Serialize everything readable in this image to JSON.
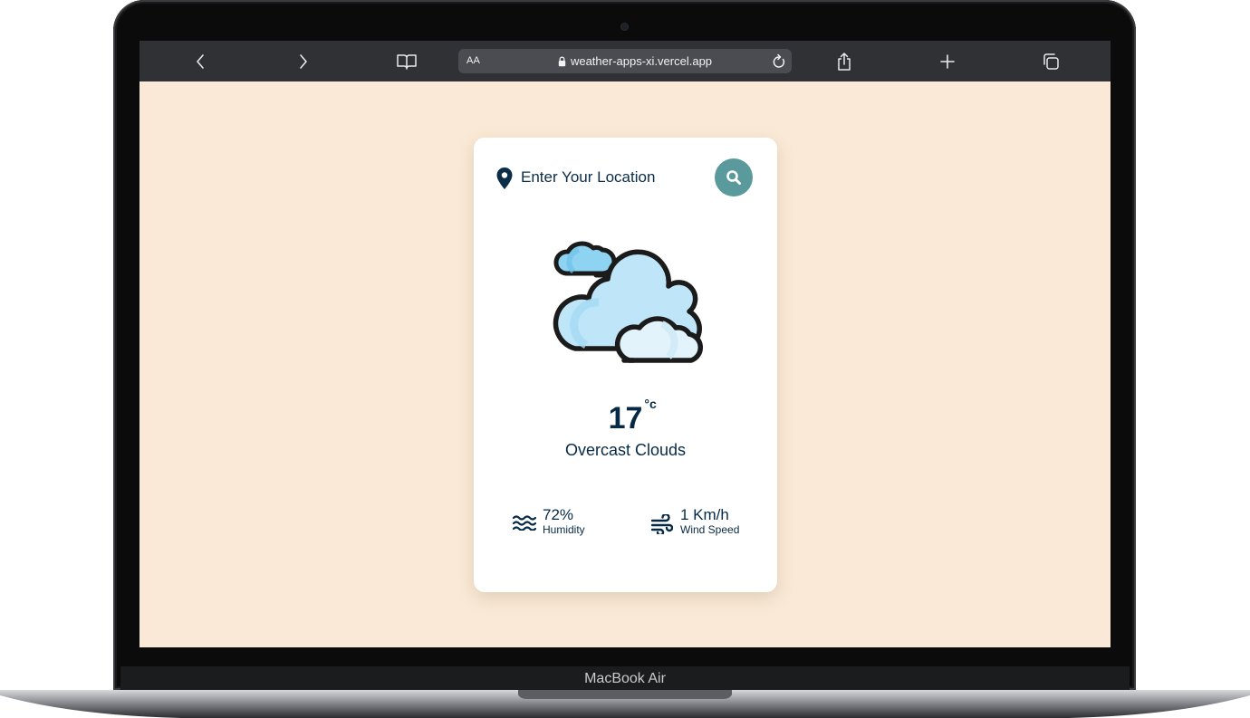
{
  "device": {
    "label": "MacBook Air"
  },
  "browser": {
    "aa_label": "AA",
    "url": "weather-apps-xi.vercel.app",
    "icons": [
      "back-icon",
      "forward-icon",
      "bookmarks-icon",
      "lock-icon",
      "reload-icon",
      "share-icon",
      "new-tab-icon",
      "tabs-icon"
    ]
  },
  "weather": {
    "search_placeholder": "Enter Your Location",
    "temperature": "17",
    "temperature_unit": "°c",
    "description": "Overcast Clouds",
    "humidity_value": "72%",
    "humidity_label": "Humidity",
    "wind_value": "1 Km/h",
    "wind_label": "Wind Speed"
  },
  "colors": {
    "page_background": "#f9e9d6",
    "text_primary": "#062a45",
    "search_button": "#5a9a9c",
    "toolbar": "#2f3135"
  }
}
